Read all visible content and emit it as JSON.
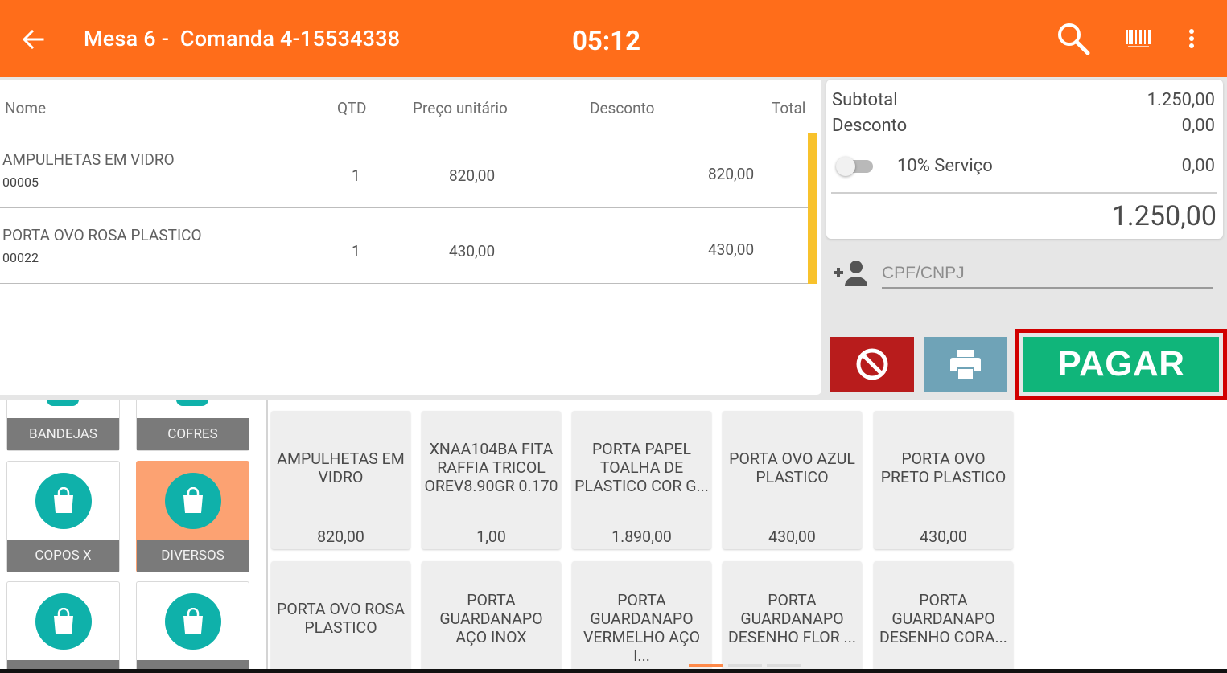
{
  "header": {
    "title": "Mesa 6 -  Comanda 4-15534338",
    "clock": "05:12"
  },
  "table": {
    "columns": {
      "name": "Nome",
      "qtd": "QTD",
      "price": "Preço unitário",
      "discount": "Desconto",
      "total": "Total"
    },
    "rows": [
      {
        "name": "AMPULHETAS EM VIDRO",
        "code": "00005",
        "qtd": "1",
        "price": "820,00",
        "total": "820,00"
      },
      {
        "name": "PORTA OVO ROSA PLASTICO",
        "code": "00022",
        "qtd": "1",
        "price": "430,00",
        "total": "430,00"
      }
    ]
  },
  "summary": {
    "subtotal_label": "Subtotal",
    "subtotal_value": "1.250,00",
    "discount_label": "Desconto",
    "discount_value": "0,00",
    "service_label": "10% Serviço",
    "service_value": "0,00",
    "service_enabled": false,
    "grand_total": "1.250,00"
  },
  "customer": {
    "placeholder": "CPF/CNPJ"
  },
  "actions": {
    "pay_label": "PAGAR"
  },
  "categories": [
    {
      "label": "BANDEJAS"
    },
    {
      "label": "COFRES"
    },
    {
      "label": "COPOS X"
    },
    {
      "label": "DIVERSOS",
      "selected": true
    },
    {
      "label": ""
    },
    {
      "label": ""
    }
  ],
  "products": [
    {
      "name": "AMPULHETAS EM VIDRO",
      "price": "820,00"
    },
    {
      "name": "XNAA104BA FITA RAFFIA TRICOL OREV8.90GR 0.170",
      "price": "1,00"
    },
    {
      "name": "PORTA PAPEL TOALHA DE PLASTICO COR G...",
      "price": "1.890,00"
    },
    {
      "name": "PORTA OVO AZUL PLASTICO",
      "price": "430,00"
    },
    {
      "name": "PORTA OVO PRETO PLASTICO",
      "price": "430,00"
    },
    {
      "name": "PORTA OVO ROSA PLASTICO",
      "price": ""
    },
    {
      "name": "PORTA GUARDANAPO AÇO INOX",
      "price": ""
    },
    {
      "name": "PORTA GUARDANAPO VERMELHO AÇO I...",
      "price": ""
    },
    {
      "name": "PORTA GUARDANAPO DESENHO FLOR ...",
      "price": ""
    },
    {
      "name": "PORTA GUARDANAPO DESENHO CORA...",
      "price": ""
    }
  ],
  "colors": {
    "appbar": "#ff6d1a",
    "pay": "#10b57a",
    "cancel": "#b81c1c",
    "print": "#6fa3b7",
    "highlight_frame": "#d10000",
    "row_marker": "#f8c22c",
    "category_icon": "#0fb1aa",
    "category_selected": "#fca272"
  }
}
